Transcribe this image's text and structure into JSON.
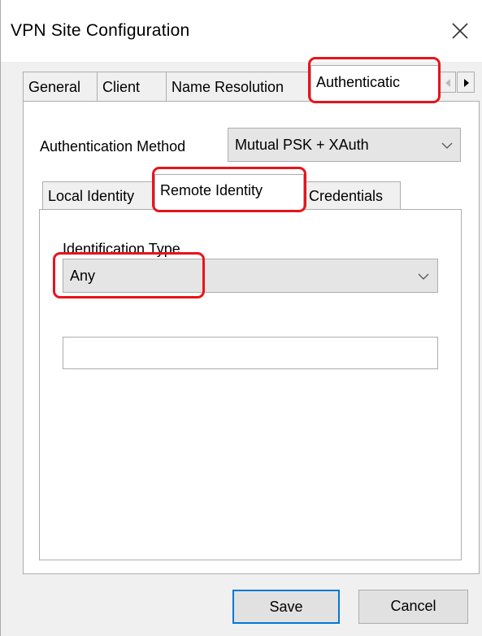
{
  "window": {
    "title": "VPN Site Configuration",
    "close_icon": "close-icon"
  },
  "outer_tabs": [
    {
      "label": "General",
      "selected": false
    },
    {
      "label": "Client",
      "selected": false
    },
    {
      "label": "Name Resolution",
      "selected": false
    },
    {
      "label": "Authenticatic",
      "selected": true
    }
  ],
  "tab_scroll": {
    "left_icon": "triangle-left-icon",
    "right_icon": "triangle-right-icon"
  },
  "authentication": {
    "method_label": "Authentication Method",
    "method_value": "Mutual PSK + XAuth"
  },
  "inner_tabs": [
    {
      "label": "Local Identity",
      "selected": false
    },
    {
      "label": "Remote Identity",
      "selected": true
    },
    {
      "label": "Credentials",
      "selected": false
    }
  ],
  "remote_identity": {
    "identification_type_label": "Identification Type",
    "identification_type_value": "Any",
    "identity_value": ""
  },
  "buttons": {
    "save": "Save",
    "cancel": "Cancel"
  },
  "colors": {
    "highlight": "#e8141b",
    "focus_border": "#0078d7"
  }
}
